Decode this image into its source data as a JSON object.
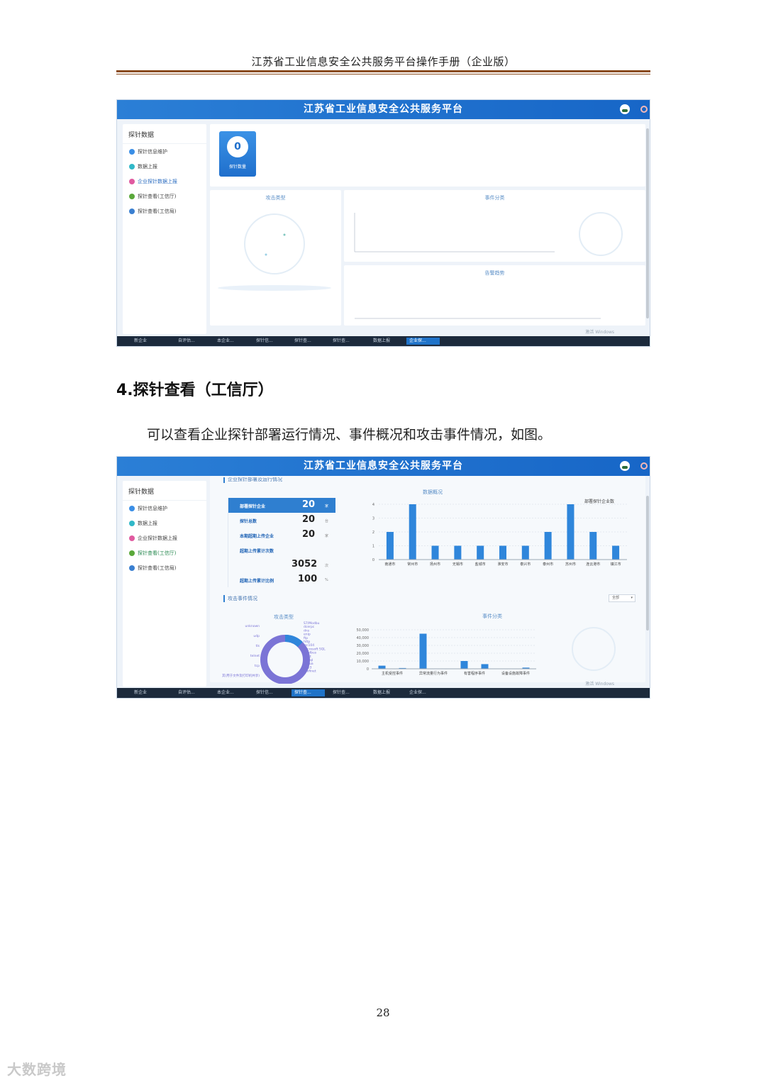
{
  "document": {
    "header": "江苏省工业信息安全公共服务平台操作手册（企业版）",
    "section_heading": "4.探针查看（工信厅）",
    "body_text": "可以查看企业探针部署运行情况、事件概况和攻击事件情况，如图。",
    "page_number": "28",
    "corner_logo": "大数跨境"
  },
  "app": {
    "title": "江苏省工业信息安全公共服务平台",
    "sidebar": {
      "title": "探针数据",
      "items": [
        {
          "label": "探针信息维护",
          "color": "#3a8ee6"
        },
        {
          "label": "数据上报",
          "color": "#30b8c8"
        },
        {
          "label": "企业探针数据上报",
          "color": "#e05aa0"
        },
        {
          "label": "探针查看(工信厅)",
          "color": "#5aa83a"
        },
        {
          "label": "探针查看(工信局)",
          "color": "#3a7fd0"
        }
      ]
    },
    "taskbar": {
      "start": "新企业",
      "tasks": [
        "自评估...",
        "本企业...",
        "探针信...",
        "探针查...",
        "探针查...",
        "数据上报",
        "企业探..."
      ],
      "watermark": "激活 Windows",
      "watermark_sub": "转到\"设置\"以激活 Windows。"
    }
  },
  "screenshot1": {
    "probe_count_value": "0",
    "probe_count_label": "探针数量",
    "panel_attack_type": "攻击类型",
    "panel_event_category": "事件分类",
    "panel_alert_trend": "告警趋势"
  },
  "screenshot2": {
    "section_title": "企业探针部署及运行情况",
    "stats": [
      {
        "label": "部署探针企业",
        "value": "20",
        "unit": "家"
      },
      {
        "label": "探针总数",
        "value": "20",
        "unit": "台"
      },
      {
        "label": "本期超期上传企业",
        "value": "20",
        "unit": "家"
      },
      {
        "label": "超期上传累计次数",
        "value": "",
        "unit": ""
      },
      {
        "label": "",
        "value": "3052",
        "unit": "次"
      },
      {
        "label": "超期上传累计比例",
        "value": "100",
        "unit": "%"
      }
    ],
    "attack_section_title": "攻击事件情况",
    "dropdown_value": "全部",
    "panel_data_overview": "数据概况",
    "panel_attack_type": "攻击类型",
    "panel_event_category": "事件分类"
  },
  "chart_data": [
    {
      "type": "bar",
      "title": "数据概况",
      "legend": "部署探针企业数",
      "categories": [
        "南通市",
        "常州市",
        "扬州市",
        "无锡市",
        "盐城市",
        "淮安市",
        "泰兴市",
        "泰州市",
        "苏州市",
        "连云港市",
        "镇江市"
      ],
      "values": [
        2,
        4,
        1,
        1,
        1,
        1,
        1,
        2,
        4,
        2,
        1
      ],
      "ylim": [
        0,
        4
      ],
      "yticks": [
        "0",
        "1",
        "2",
        "3",
        "4"
      ],
      "color": "#2f86db"
    },
    {
      "type": "bar",
      "title": "事件分类",
      "categories": [
        "主机受控事件",
        "异常流量行为事件",
        "有害程序事件",
        "设备设施故障事件"
      ],
      "values": [
        4000,
        1000,
        45000,
        0,
        10000,
        6000,
        0,
        1500
      ],
      "ylim": [
        0,
        50000
      ],
      "yticks": [
        "0",
        "10,000",
        "20,000",
        "30,000",
        "40,000",
        "50,000"
      ],
      "color": "#2f86db"
    },
    {
      "type": "pie",
      "title": "攻击类型",
      "labels": [
        "S7/Modbu",
        "dcerpc",
        "dns",
        "enip",
        "ftp",
        "http",
        "iec104",
        "Microsoft SQL",
        "modbus",
        "mqtt",
        "mssql",
        "opcua",
        "pop3",
        "profinet",
        "unknown",
        "udp",
        "tls",
        "telnet",
        "tcp",
        "其(用于文件及打印机共享)"
      ],
      "colors": [
        "#2f86db",
        "#7b74d6",
        "#8f86de"
      ]
    }
  ]
}
